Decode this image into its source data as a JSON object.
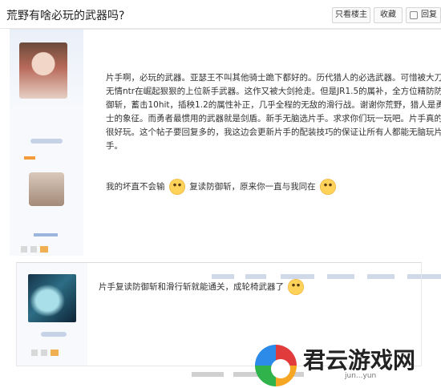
{
  "thread": {
    "title": "荒野有啥必玩的武器吗?"
  },
  "header_buttons": [
    {
      "label": "只看楼主"
    },
    {
      "label": "收藏"
    },
    {
      "label": "回复"
    }
  ],
  "posts": [
    {
      "content": "片手啊，必玩的武器。亚瑟王不叫其他骑士跪下都好的。历代猎人的必选武器。可惜被大刀无情ntr在崛起狠狠的上位新手武器。这作又被大剑抢走。但是JR1.5的属补，全方位精防防御斩，蓄击10hit，插秧1.2的属性补正，几乎全程的无敌的滑行战。谢谢你荒野，猎人是勇士的象征。而勇者最惯用的武器就是剑盾。新手无脑选片手。求求你们玩一玩吧。片手真的很好玩。这个帖子要回复多的，我这边会更新片手的配装技巧的保证让所有人都能无脑玩片手。",
      "line2_a": "我的坏直不会输",
      "line2_b": "复读防御斩，原来你一直与我同在"
    },
    {
      "content": "片手复读防御斩和滑行斩就能通关，成轮椅武器了"
    }
  ],
  "watermark": {
    "title": "君云游戏网",
    "subtitle": "jun...yun"
  }
}
